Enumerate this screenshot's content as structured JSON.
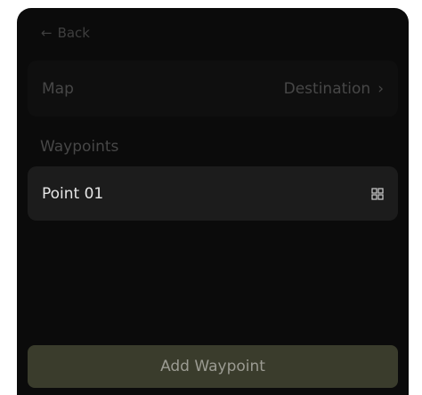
{
  "back": {
    "icon": "arrow-left-icon",
    "label": "Back"
  },
  "map_row": {
    "label": "Map",
    "value": "Destination",
    "chevron": "chevron-right-icon"
  },
  "waypoints": {
    "section_title": "Waypoints",
    "items": [
      {
        "name": "Point 01",
        "icon": "qr-code-icon"
      }
    ]
  },
  "actions": {
    "add_label": "Add Waypoint"
  },
  "colors": {
    "panel_bg": "#0b0b0b",
    "row_bg": "#1c1c1c",
    "accent_button": "#3a3c2c",
    "muted_text": "#474747",
    "primary_text": "#e6e6e6"
  }
}
